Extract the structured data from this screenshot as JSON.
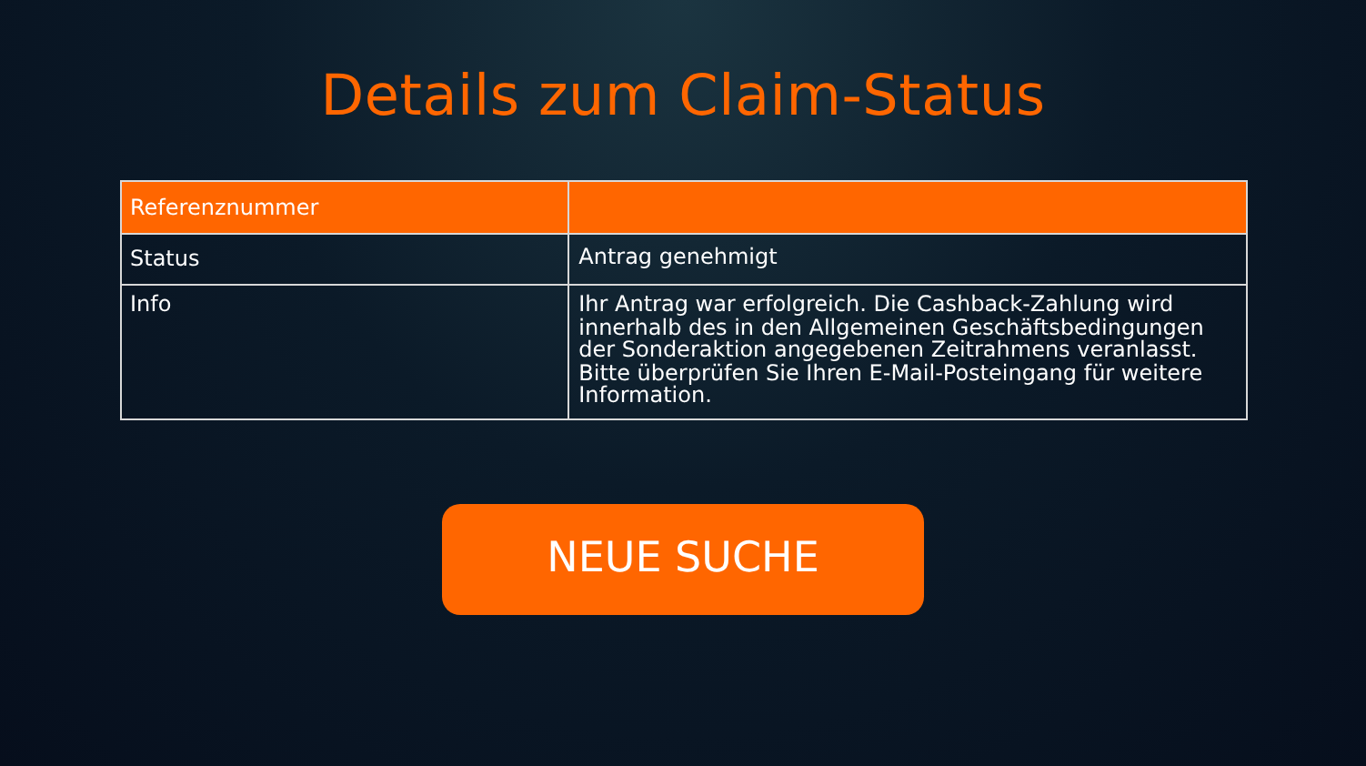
{
  "title": "Details zum Claim-Status",
  "table": {
    "rows": [
      {
        "kind": "header",
        "label": "Referenznummer"
      },
      {
        "kind": "body",
        "label": "Status",
        "value": "Antrag genehmigt"
      },
      {
        "kind": "body",
        "label": "Info",
        "value": "Ihr Antrag war erfolgreich. Die Cashback-Zahlung wird innerhalb des in den Allgemeinen Geschäftsbedingungen der Sonderaktion angegebenen Zeitrahmens veranlasst. Bitte überprüfen Sie Ihren E-Mail-Posteingang für weitere Information."
      }
    ]
  },
  "button": "NEUE SUCHE"
}
